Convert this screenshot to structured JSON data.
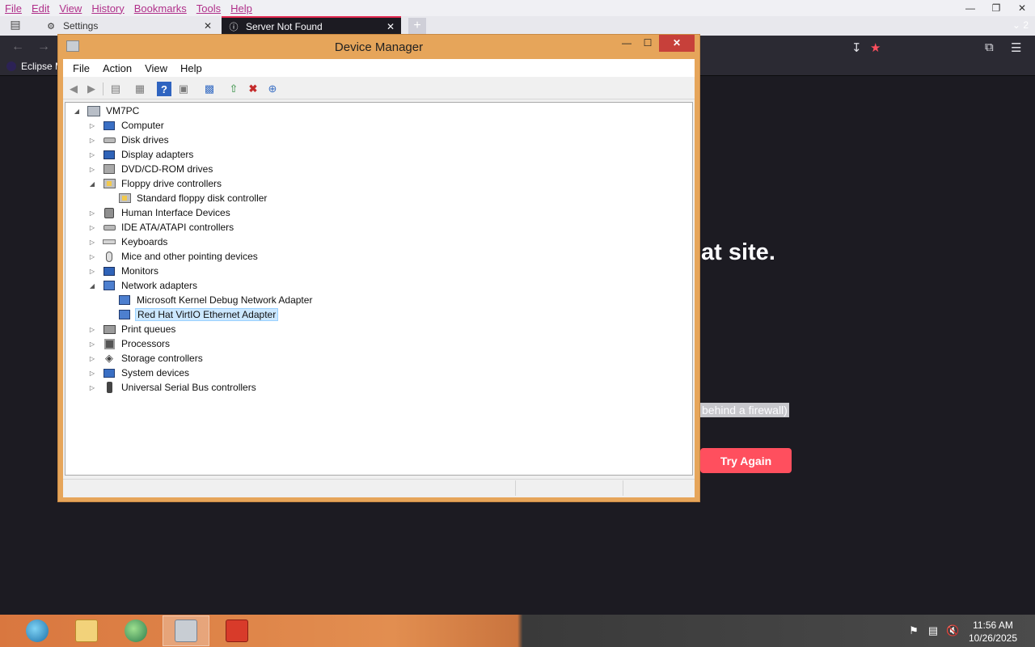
{
  "browser": {
    "menu": [
      "File",
      "Edit",
      "View",
      "History",
      "Bookmarks",
      "Tools",
      "Help"
    ],
    "tabs": [
      {
        "label": "Settings"
      },
      {
        "label": "Server Not Found"
      }
    ],
    "tab_count": "2",
    "bookmark": "Eclipse M",
    "page": {
      "heading_fragment": "at site.",
      "firewall_fragment": "behind a firewall)",
      "try_again": "Try Again"
    },
    "accent_color": "#ff4f5e"
  },
  "device_manager": {
    "title": "Device Manager",
    "menu": [
      "File",
      "Action",
      "View",
      "Help"
    ],
    "root": "VM7PC",
    "tree": [
      {
        "label": "Computer",
        "expanded": false,
        "icon": "computer-icon"
      },
      {
        "label": "Disk drives",
        "expanded": false,
        "icon": "disk-drive-icon"
      },
      {
        "label": "Display adapters",
        "expanded": false,
        "icon": "display-adapter-icon"
      },
      {
        "label": "DVD/CD-ROM drives",
        "expanded": false,
        "icon": "dvd-drive-icon"
      },
      {
        "label": "Floppy drive controllers",
        "expanded": true,
        "icon": "floppy-controller-icon",
        "children": [
          {
            "label": "Standard floppy disk controller",
            "icon": "floppy-controller-icon"
          }
        ]
      },
      {
        "label": "Human Interface Devices",
        "expanded": false,
        "icon": "hid-icon"
      },
      {
        "label": "IDE ATA/ATAPI controllers",
        "expanded": false,
        "icon": "ide-controller-icon"
      },
      {
        "label": "Keyboards",
        "expanded": false,
        "icon": "keyboard-icon"
      },
      {
        "label": "Mice and other pointing devices",
        "expanded": false,
        "icon": "mouse-icon"
      },
      {
        "label": "Monitors",
        "expanded": false,
        "icon": "monitor-icon"
      },
      {
        "label": "Network adapters",
        "expanded": true,
        "icon": "network-adapter-icon",
        "children": [
          {
            "label": "Microsoft Kernel Debug Network Adapter",
            "icon": "network-adapter-icon"
          },
          {
            "label": "Red Hat VirtIO Ethernet Adapter",
            "icon": "network-adapter-icon",
            "selected": true
          }
        ]
      },
      {
        "label": "Print queues",
        "expanded": false,
        "icon": "printer-icon"
      },
      {
        "label": "Processors",
        "expanded": false,
        "icon": "processor-icon"
      },
      {
        "label": "Storage controllers",
        "expanded": false,
        "icon": "storage-controller-icon"
      },
      {
        "label": "System devices",
        "expanded": false,
        "icon": "system-device-icon"
      },
      {
        "label": "Universal Serial Bus controllers",
        "expanded": false,
        "icon": "usb-icon"
      }
    ],
    "selection_color": "#cce8ff"
  },
  "taskbar": {
    "apps": [
      "browser-icon",
      "file-explorer-icon",
      "network-icon",
      "device-manager-icon",
      "app-icon"
    ],
    "time": "11:56 AM",
    "date": "10/26/2025"
  }
}
